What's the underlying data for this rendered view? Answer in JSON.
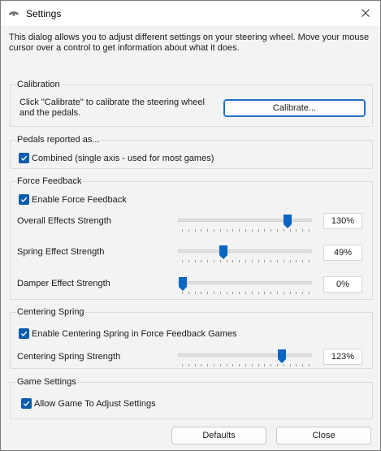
{
  "window": {
    "title": "Settings",
    "icon": "steering-wheel-icon"
  },
  "intro": "This dialog allows you to adjust different settings on your steering wheel.  Move your mouse cursor over a control to get information about what it does.",
  "calibration": {
    "title": "Calibration",
    "text": "Click \"Calibrate\" to calibrate the steering wheel and the pedals.",
    "button": "Calibrate..."
  },
  "pedals": {
    "title": "Pedals reported as...",
    "combined_label": "Combined (single axis - used for most games)",
    "combined_checked": true
  },
  "force_feedback": {
    "title": "Force Feedback",
    "enable_label": "Enable Force Feedback",
    "enable_checked": true,
    "sliders": [
      {
        "label": "Overall Effects Strength",
        "value_text": "130%",
        "fraction": 0.84
      },
      {
        "label": "Spring Effect Strength",
        "value_text": "49%",
        "fraction": 0.33
      },
      {
        "label": "Damper Effect Strength",
        "value_text": "0%",
        "fraction": 0.0
      }
    ]
  },
  "centering_spring": {
    "title": "Centering Spring",
    "enable_label": "Enable Centering Spring in Force Feedback Games",
    "enable_checked": true,
    "slider": {
      "label": "Centering Spring Strength",
      "value_text": "123%",
      "fraction": 0.8
    }
  },
  "game_settings": {
    "title": "Game Settings",
    "allow_label": "Allow Game To Adjust Settings",
    "allow_checked": true
  },
  "footer": {
    "defaults": "Defaults",
    "close": "Close"
  },
  "colors": {
    "accent": "#0b5cad",
    "thumb": "#0a66c2",
    "window_bg": "#f3f3f3"
  }
}
